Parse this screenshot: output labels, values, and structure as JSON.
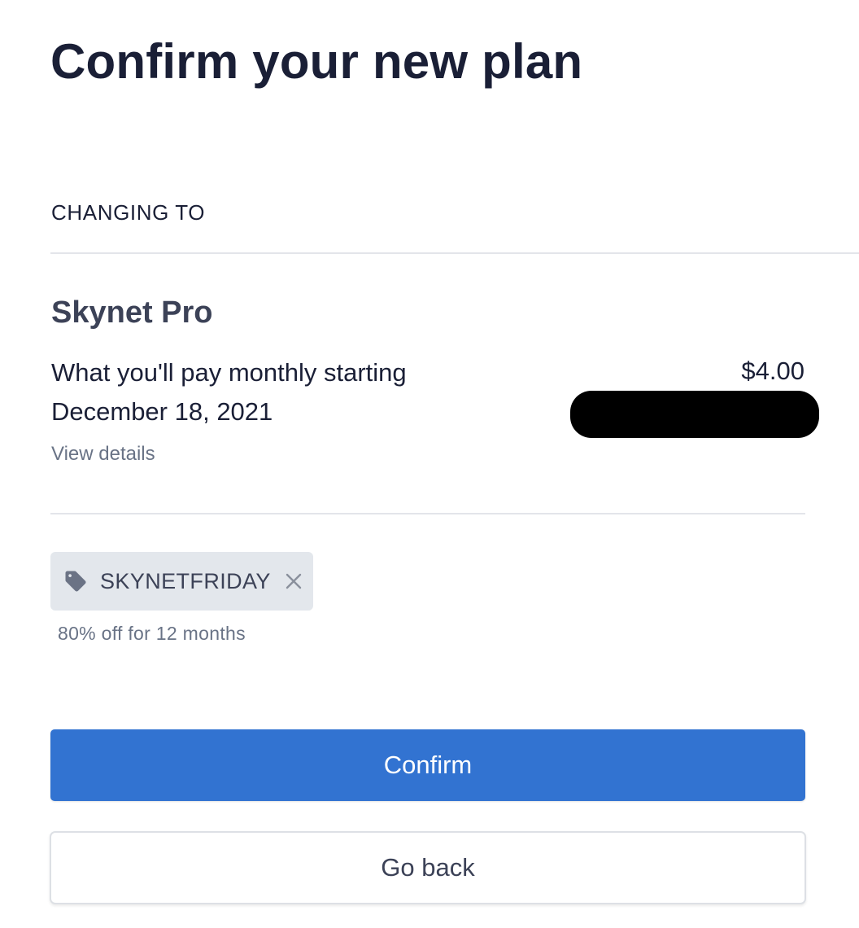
{
  "page": {
    "title": "Confirm your new plan"
  },
  "plan": {
    "section_label": "CHANGING TO",
    "name": "Skynet Pro",
    "pay_description": "What you'll pay monthly starting December 18, 2021",
    "price": "$4.00",
    "view_details_label": "View details"
  },
  "coupon": {
    "icon": "tag-icon",
    "code": "SKYNETFRIDAY",
    "remove_icon": "close-icon",
    "description": "80% off for 12 months"
  },
  "actions": {
    "confirm_label": "Confirm",
    "back_label": "Go back"
  },
  "colors": {
    "primary": "#3273d1",
    "heading": "#1a1f36",
    "muted": "#697386",
    "chip_background": "#e3e7ec",
    "redaction": "#000000"
  }
}
